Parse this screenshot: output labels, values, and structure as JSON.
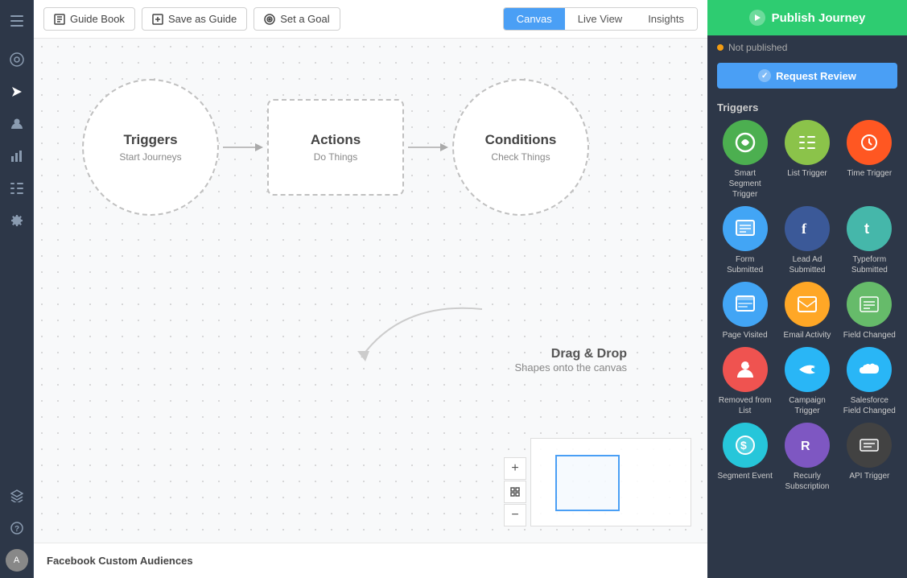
{
  "toolbar": {
    "guide_book_label": "Guide Book",
    "save_as_guide_label": "Save as Guide",
    "set_a_goal_label": "Set a Goal",
    "canvas_tab_label": "Canvas",
    "live_view_tab_label": "Live View",
    "insights_tab_label": "Insights",
    "active_tab": "Canvas"
  },
  "canvas": {
    "triggers_node": {
      "title": "Triggers",
      "subtitle": "Start Journeys"
    },
    "actions_node": {
      "title": "Actions",
      "subtitle": "Do Things"
    },
    "conditions_node": {
      "title": "Conditions",
      "subtitle": "Check Things"
    },
    "drag_hint_title": "Drag & Drop",
    "drag_hint_sub": "Shapes onto the canvas"
  },
  "bottom_bar": {
    "label": "Facebook Custom Audiences"
  },
  "publish": {
    "btn_label": "Publish Journey",
    "status_label": "Not published",
    "review_btn_label": "Request Review"
  },
  "triggers_section": {
    "title": "Triggers",
    "items": [
      {
        "id": "smart-segment",
        "label": "Smart Segment Trigger",
        "color": "#4CAF50",
        "icon": "↻"
      },
      {
        "id": "list-trigger",
        "label": "List Trigger",
        "color": "#8BC34A",
        "icon": "☰"
      },
      {
        "id": "time-trigger",
        "label": "Time Trigger",
        "color": "#FF5722",
        "icon": "⏰"
      },
      {
        "id": "form-submitted",
        "label": "Form Submitted",
        "color": "#42A5F5",
        "icon": "▦"
      },
      {
        "id": "lead-ad",
        "label": "Lead Ad Submitted",
        "color": "#3B5998",
        "icon": "f"
      },
      {
        "id": "typeform",
        "label": "Typeform Submitted",
        "color": "#45B7AA",
        "icon": "t"
      },
      {
        "id": "page-visited",
        "label": "Page Visited",
        "color": "#42A5F5",
        "icon": "⬜"
      },
      {
        "id": "email-activity",
        "label": "Email Activity",
        "color": "#FFA726",
        "icon": "✉"
      },
      {
        "id": "field-changed",
        "label": "Field Changed",
        "color": "#66BB6A",
        "icon": "☰"
      },
      {
        "id": "removed-from-list",
        "label": "Removed from List",
        "color": "#EF5350",
        "icon": "👤"
      },
      {
        "id": "campaign-trigger",
        "label": "Campaign Trigger",
        "color": "#29B6F6",
        "icon": "☁"
      },
      {
        "id": "salesforce-field",
        "label": "Salesforce Field Changed",
        "color": "#29B6F6",
        "icon": "☁"
      },
      {
        "id": "segment-event",
        "label": "Segment Event",
        "color": "#26C6DA",
        "icon": "$"
      },
      {
        "id": "recurly",
        "label": "Recurly Subscription",
        "color": "#7E57C2",
        "icon": "R"
      },
      {
        "id": "api-trigger",
        "label": "API Trigger",
        "color": "#424242",
        "icon": "≡"
      }
    ]
  },
  "sidebar_nav": {
    "icons": [
      {
        "id": "menu",
        "icon": "☰",
        "active": false
      },
      {
        "id": "journey",
        "icon": "◎",
        "active": false
      },
      {
        "id": "send",
        "icon": "▶",
        "active": true
      },
      {
        "id": "contacts",
        "icon": "👤",
        "active": false
      },
      {
        "id": "analytics",
        "icon": "📊",
        "active": false
      },
      {
        "id": "lists",
        "icon": "☰",
        "active": false
      },
      {
        "id": "settings",
        "icon": "⚙",
        "active": false
      },
      {
        "id": "learn",
        "icon": "🎓",
        "active": false
      },
      {
        "id": "help",
        "icon": "?",
        "active": false
      }
    ]
  },
  "zoom_controls": {
    "plus_label": "+",
    "mid_label": "+",
    "minus_label": "−"
  }
}
